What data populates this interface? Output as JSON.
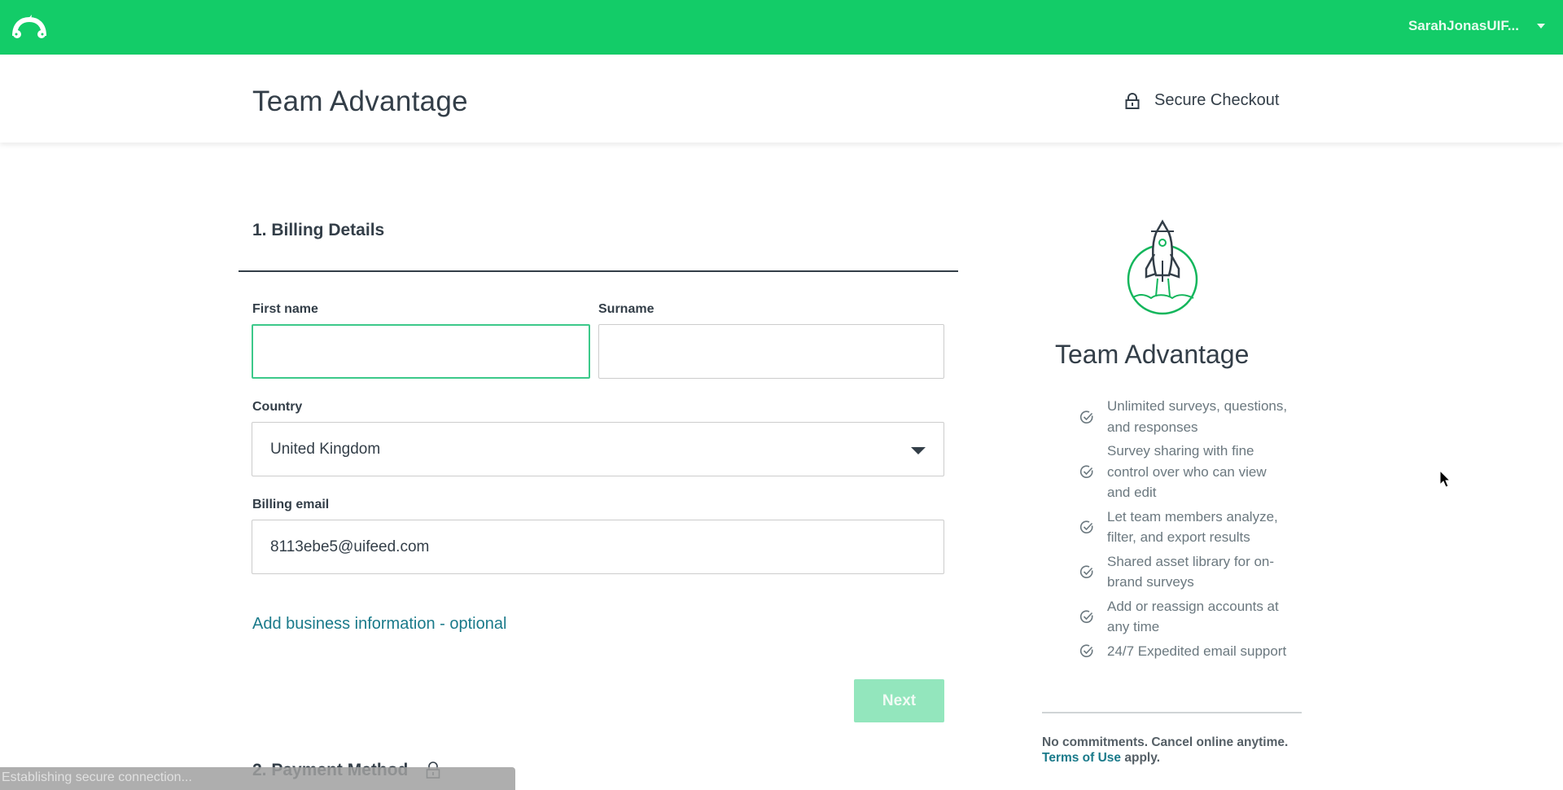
{
  "topbar": {
    "logo_icon": "surveymonkey-logo-icon",
    "user_name": "SarahJonasUIF...",
    "user_menu_icon": "caret-down-icon",
    "brand_color": "#13cc68"
  },
  "header": {
    "title": "Team Advantage",
    "secure_icon": "lock-icon",
    "secure_label": "Secure Checkout"
  },
  "billing": {
    "section_title": "1. Billing Details",
    "first_name": {
      "label": "First name",
      "value": "",
      "placeholder": ""
    },
    "surname": {
      "label": "Surname",
      "value": "",
      "placeholder": ""
    },
    "country": {
      "label": "Country",
      "selected": "United Kingdom"
    },
    "email": {
      "label": "Billing email",
      "value": "8113ebe5@uifeed.com"
    },
    "business_link": "Add business information - optional",
    "next_label": "Next"
  },
  "payment": {
    "section_title": "2. Payment Method",
    "icon": "lock-icon"
  },
  "status_bar": {
    "text": "Establishing secure connection..."
  },
  "plan": {
    "icon": "rocket-icon",
    "title": "Team Advantage",
    "features": [
      "Unlimited surveys, questions, and responses",
      "Survey sharing with fine control over who can view and edit",
      "Let team members analyze, filter, and export results",
      "Shared asset library for on-brand surveys",
      "Add or reassign accounts at any time",
      "24/7 Expedited email support"
    ],
    "commitment_text": "No commitments. Cancel online anytime.",
    "terms_link": "Terms of Use",
    "terms_suffix": " apply."
  }
}
